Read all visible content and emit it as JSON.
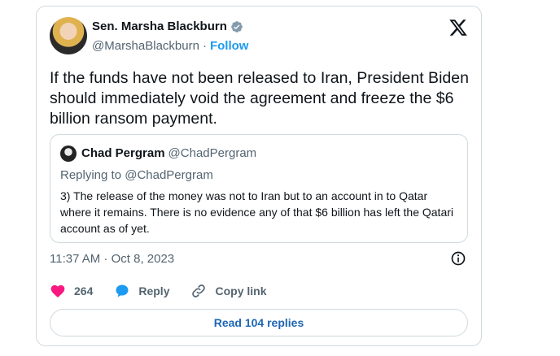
{
  "author": {
    "name": "Sen. Marsha Blackburn",
    "handle": "@MarshaBlackburn",
    "separator": "·",
    "follow_label": "Follow",
    "avatar_icon": "avatar-photo",
    "verified_icon": "verified-badge-icon"
  },
  "tweet": {
    "text": "If the funds have not been released to Iran, President Biden should immediately void the agreement and freeze the $6 billion ransom payment."
  },
  "quote": {
    "name": "Chad Pergram",
    "handle": "@ChadPergram",
    "replying_to": "Replying to @ChadPergram",
    "text": "3) The release of the money was not to Iran but to an account in to Qatar where it remains. There is no evidence any of that $6 billion has left the Qatari account as of yet."
  },
  "meta": {
    "timestamp": "11:37 AM · Oct 8, 2023"
  },
  "actions": {
    "like_count": "264",
    "reply_label": "Reply",
    "copy_link_label": "Copy link"
  },
  "footer": {
    "read_replies_label": "Read 104 replies"
  },
  "colors": {
    "accent": "#1d9bf0",
    "like": "#f91880",
    "muted": "#536471",
    "border": "#cfd9de"
  }
}
